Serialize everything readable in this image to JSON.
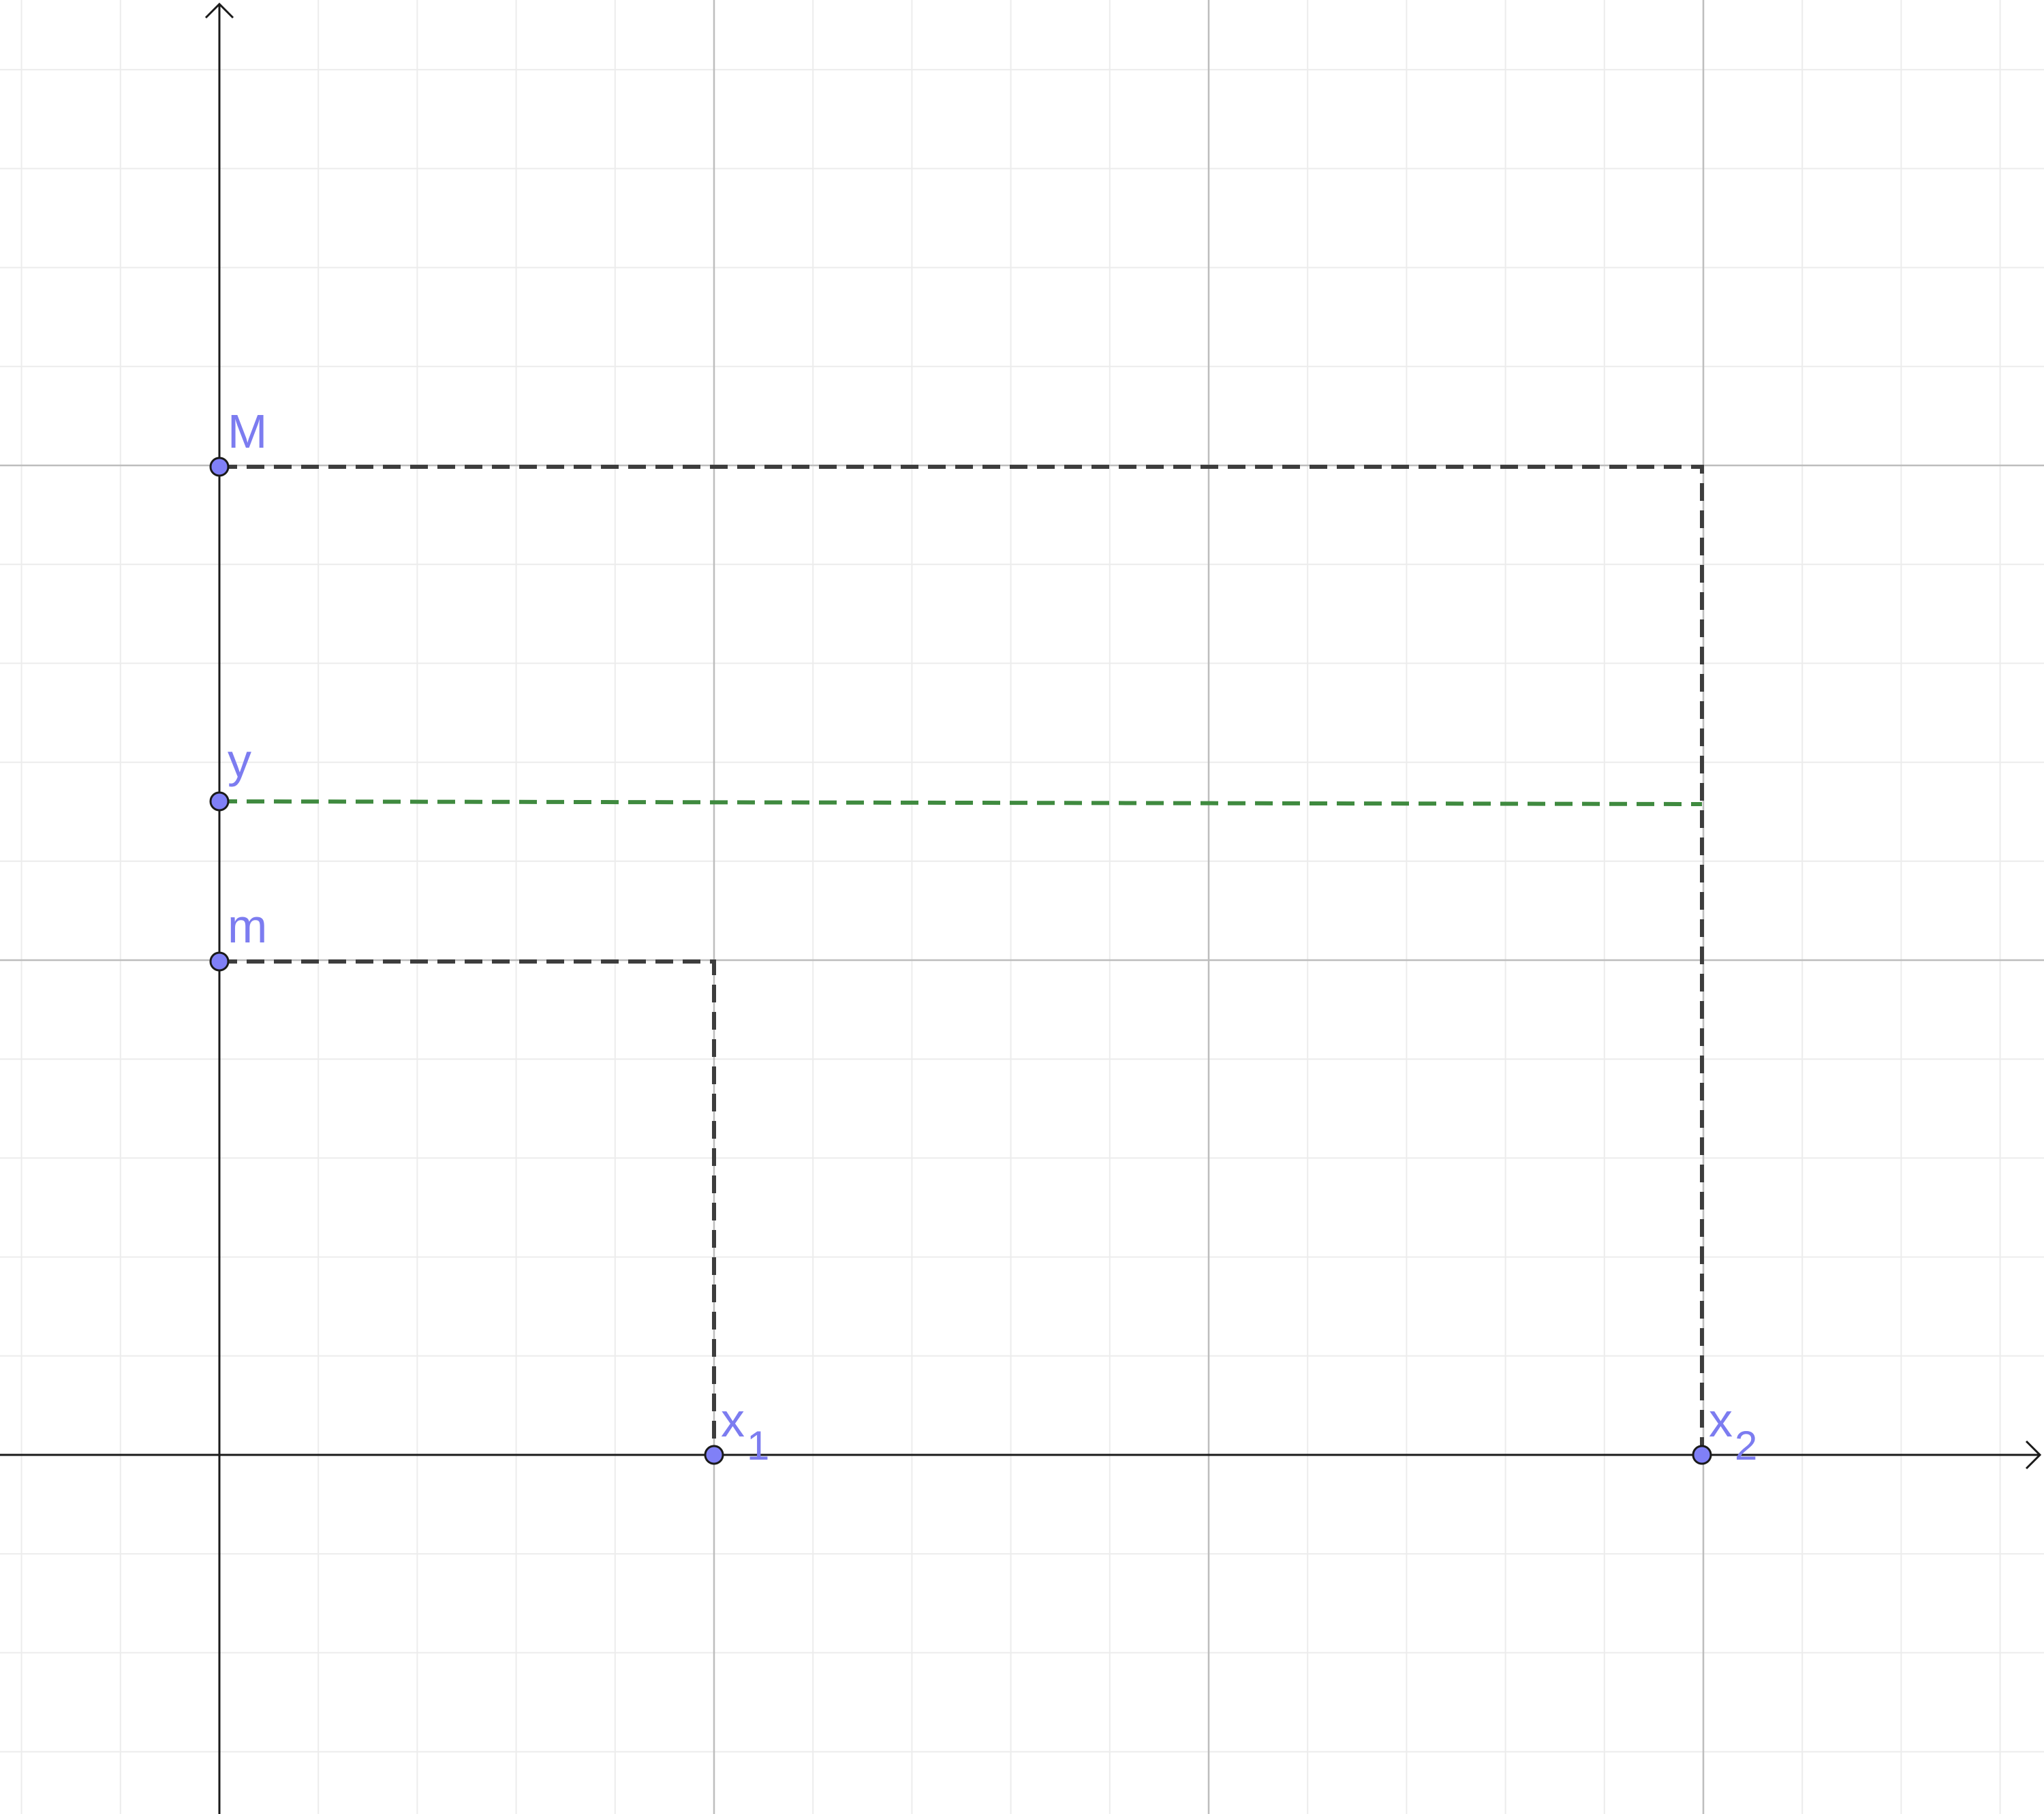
{
  "colors": {
    "background": "#ffffff",
    "minor_grid": "#ececec",
    "major_grid": "#bdbdbd",
    "axis": "#1a1a1a",
    "guide_dashed": "#3d3d3d",
    "level_dashed": "#3f8a3f",
    "point_fill": "#8080f7",
    "point_stroke": "#1a1a1a",
    "label": "#7c7cf0"
  },
  "points": {
    "M": {
      "label": "M"
    },
    "y": {
      "label": "y"
    },
    "m": {
      "label": "m"
    },
    "x1": {
      "label": "x",
      "subscript": "1"
    },
    "x2": {
      "label": "x",
      "subscript": "2"
    }
  }
}
